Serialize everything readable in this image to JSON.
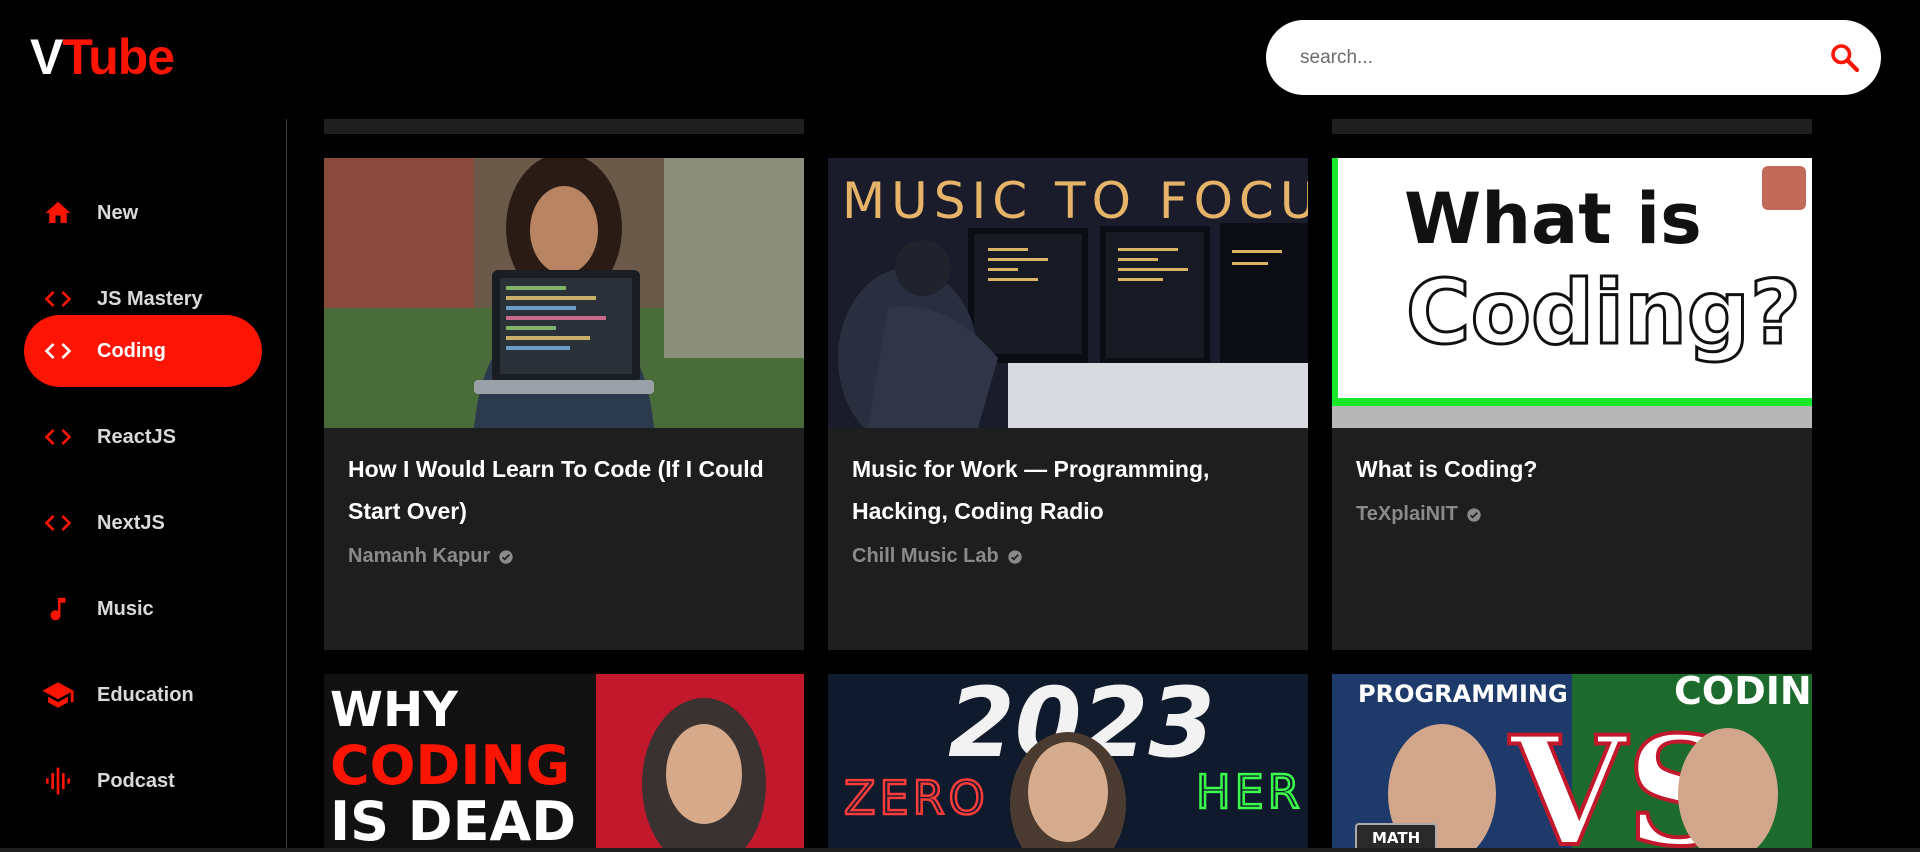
{
  "brand": {
    "logo_first": "V",
    "logo_rest": "Tube",
    "accent": "#fc1503"
  },
  "search": {
    "placeholder": "search..."
  },
  "sidebar": {
    "items": [
      {
        "label": "New",
        "icon": "home-icon",
        "active": false
      },
      {
        "label": "JS Mastery",
        "icon": "code-icon",
        "active": false
      },
      {
        "label": "Coding",
        "icon": "code-icon",
        "active": true
      },
      {
        "label": "ReactJS",
        "icon": "code-icon",
        "active": false
      },
      {
        "label": "NextJS",
        "icon": "code-icon",
        "active": false
      },
      {
        "label": "Music",
        "icon": "music-note-icon",
        "active": false
      },
      {
        "label": "Education",
        "icon": "graduation-cap-icon",
        "active": false
      },
      {
        "label": "Podcast",
        "icon": "graphic-eq-icon",
        "active": false
      }
    ]
  },
  "videos": [
    {
      "title": "How I Would Learn To Code (If I Could Start Over)",
      "channel": "Namanh Kapur",
      "thumb_text": ""
    },
    {
      "title": "Music for Work — Programming, Hacking, Coding Radio",
      "channel": "Chill Music Lab",
      "thumb_text": "MUSIC TO FOCU"
    },
    {
      "title": "What is Coding?",
      "channel": "TeXplaiNIT",
      "thumb_text_1": "What is",
      "thumb_text_2": "Coding?"
    },
    {
      "thumb_line1": "WHY",
      "thumb_line2": "CODING",
      "thumb_line3": "IS DEAD"
    },
    {
      "thumb_year": "2023",
      "thumb_left": "ZERO",
      "thumb_right": "HER"
    },
    {
      "thumb_left": "PROGRAMMING",
      "thumb_right": "CODIN",
      "thumb_vs": "VS",
      "thumb_tag": "MATH"
    }
  ]
}
